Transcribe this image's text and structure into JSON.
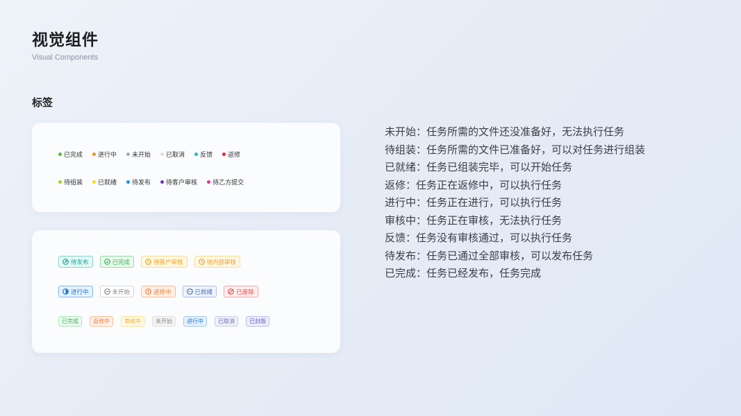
{
  "header": {
    "title": "视觉组件",
    "subtitle": "Visual Components"
  },
  "section": {
    "title": "标签"
  },
  "dot_tags": {
    "row1": [
      {
        "label": "已完成",
        "color": "#52c41a"
      },
      {
        "label": "进行中",
        "color": "#fa8c16"
      },
      {
        "label": "未开始",
        "color": "#a8a8a8"
      },
      {
        "label": "已取消",
        "color": "#dcdcdc"
      },
      {
        "label": "反馈",
        "color": "#13c2c2"
      },
      {
        "label": "返修",
        "color": "#f5222d"
      }
    ],
    "row2": [
      {
        "label": "待组装",
        "color": "#a0d911"
      },
      {
        "label": "已就绪",
        "color": "#fadb14"
      },
      {
        "label": "待发布",
        "color": "#1890ff"
      },
      {
        "label": "待客户审核",
        "color": "#722ed1"
      },
      {
        "label": "待乙方提交",
        "color": "#eb2f96"
      }
    ]
  },
  "icon_tags": {
    "row1": [
      {
        "label": "待发布",
        "icon": "send-icon",
        "color": "#13a89e",
        "bg": "#e8f8f5",
        "border": "#7fd8c9"
      },
      {
        "label": "已完成",
        "icon": "check-circle-icon",
        "color": "#38b45a",
        "bg": "#edf9ef",
        "border": "#8fdca4"
      },
      {
        "label": "待客户审核",
        "icon": "clock-icon",
        "color": "#f0a020",
        "bg": "#fff8e6",
        "border": "#ffd98a"
      },
      {
        "label": "待内部审核",
        "icon": "clock-icon",
        "color": "#f0a020",
        "bg": "#fff8e6",
        "border": "#ffd98a"
      }
    ],
    "row2": [
      {
        "label": "进行中",
        "icon": "half-circle-icon",
        "color": "#1677d2",
        "bg": "#e6f2ff",
        "border": "#7fb8ef"
      },
      {
        "label": "未开始",
        "icon": "minus-circle-icon",
        "color": "#888888",
        "bg": "#ffffff",
        "border": "#d6d6d6"
      },
      {
        "label": "返修中",
        "icon": "clock-icon",
        "color": "#f07a30",
        "bg": "#fff1e8",
        "border": "#ffbb92"
      },
      {
        "label": "已就绪",
        "icon": "dots-circle-icon",
        "color": "#4a6fc0",
        "bg": "#eef3fc",
        "border": "#aebfe6"
      },
      {
        "label": "已废除",
        "icon": "ban-icon",
        "color": "#e8464a",
        "bg": "#fff0f0",
        "border": "#f5a5a7"
      }
    ],
    "row3": [
      {
        "label": "已完成",
        "color": "#38b45a",
        "bg": "#eefaf0",
        "border": "#a8e4b8"
      },
      {
        "label": "返修中",
        "color": "#f07a30",
        "bg": "#fff1e8",
        "border": "#ffbb92"
      },
      {
        "label": "审核中",
        "color": "#f0b020",
        "bg": "#fffae8",
        "border": "#ffe08a"
      },
      {
        "label": "未开始",
        "color": "#888888",
        "bg": "#f3f3f3",
        "border": "#e0e0e0"
      },
      {
        "label": "进行中",
        "color": "#1677d2",
        "bg": "#e6f2ff",
        "border": "#9cc8f2"
      },
      {
        "label": "已取消",
        "color": "#6a70b0",
        "bg": "#f0f0fa",
        "border": "#c8cbeb"
      },
      {
        "label": "已封版",
        "color": "#5a5fc8",
        "bg": "#eeeefc",
        "border": "#b8baf0"
      }
    ]
  },
  "descriptions": [
    "未开始：任务所需的文件还没准备好，无法执行任务",
    "待组装：任务所需的文件已准备好，可以对任务进行组装",
    "已就绪：任务已组装完毕，可以开始任务",
    "返修：任务正在返修中，可以执行任务",
    "进行中：任务正在进行，可以执行任务",
    "审核中：任务正在审核，无法执行任务",
    "反馈：任务没有审核通过，可以执行任务",
    "待发布：任务已通过全部审核，可以发布任务",
    "已完成：任务已经发布，任务完成"
  ]
}
